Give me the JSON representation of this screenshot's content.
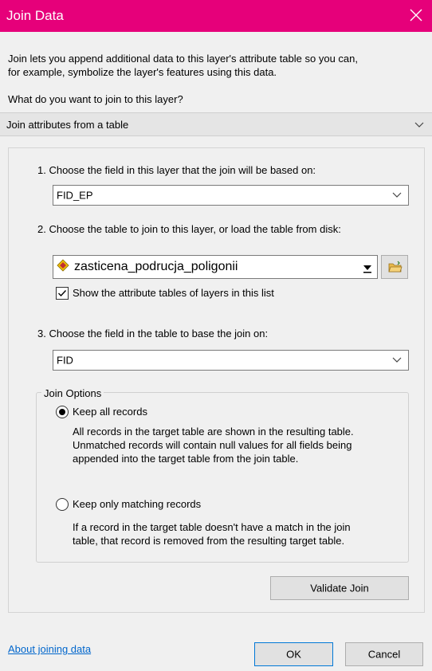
{
  "window": {
    "title": "Join Data"
  },
  "intro": {
    "line1": "Join lets you append additional data to this layer's attribute table so you can,",
    "line2": "for example, symbolize the layer's features using this data."
  },
  "question": "What do you want to join to this layer?",
  "join_type": {
    "selected": "Join attributes from a table"
  },
  "step1": {
    "label": "1.  Choose the field in this layer that the join will be based on:",
    "value": "FID_EP"
  },
  "step2": {
    "label": "2.  Choose the table to join to this layer, or load the table from disk:",
    "value": "zasticena_podrucja_poligonii",
    "checkbox_label": "Show the attribute tables of layers in this list",
    "checkbox_checked": true
  },
  "step3": {
    "label": "3.  Choose the field in the table to base the join on:",
    "value": "FID"
  },
  "options": {
    "title": "Join Options",
    "keep_all": {
      "label": "Keep all records",
      "selected": true,
      "desc1": "All records in the target table are shown in the resulting table.",
      "desc2": "Unmatched records will contain null values for all fields being",
      "desc3": "appended into the target table from the join table."
    },
    "keep_matching": {
      "label": "Keep only matching records",
      "selected": false,
      "desc1": "If a record in the target table doesn't have a match in the join",
      "desc2": "table, that record is removed from the resulting target table."
    }
  },
  "buttons": {
    "validate": "Validate Join",
    "ok": "OK",
    "cancel": "Cancel"
  },
  "link": "About joining data",
  "colors": {
    "titlebar": "#e6007a",
    "link": "#0066cc",
    "ok_border": "#0078d7"
  }
}
